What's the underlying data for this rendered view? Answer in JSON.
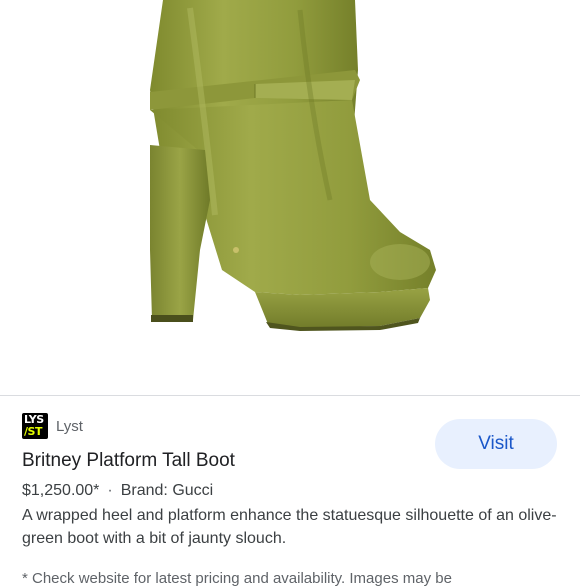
{
  "product_image": {
    "icon": "boot-image",
    "boot_color": "#8f9a3c"
  },
  "source": {
    "logo_lines": [
      "LYS",
      "/ST"
    ],
    "name": "Lyst"
  },
  "visit_button": {
    "label": "Visit"
  },
  "product": {
    "title": "Britney Platform Tall Boot",
    "price": "$1,250.00*",
    "separator": "·",
    "brand": "Brand: Gucci",
    "description": "A wrapped heel and platform enhance the statuesque silhouette of an olive-green boot with a bit of jaunty slouch.",
    "disclaimer": "* Check website for latest pricing and availability. Images may be"
  },
  "colors": {
    "accent": "#1a57c9",
    "button_bg": "#e8f0fe",
    "divider": "#dadce0"
  }
}
